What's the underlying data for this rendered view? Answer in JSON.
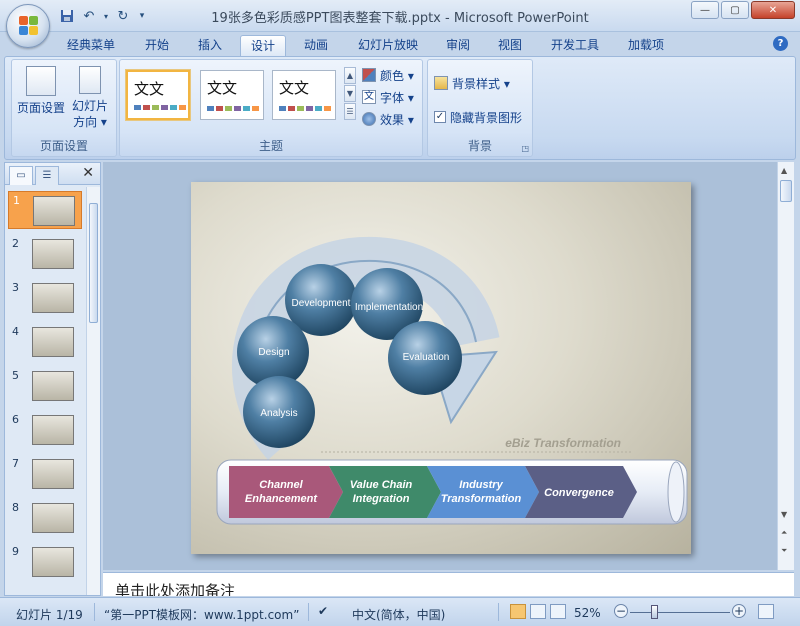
{
  "window": {
    "title": "19张多色彩质感PPT图表整套下载.pptx - Microsoft PowerPoint",
    "minimize": "—",
    "maximize": "▢",
    "close": "✕"
  },
  "quick_access": {
    "save_icon": "save-icon",
    "undo_icon": "undo-icon",
    "redo_icon": "redo-icon"
  },
  "tabs": [
    {
      "label": "经典菜单",
      "active": false
    },
    {
      "label": "开始",
      "active": false
    },
    {
      "label": "插入",
      "active": false
    },
    {
      "label": "设计",
      "active": true
    },
    {
      "label": "动画",
      "active": false
    },
    {
      "label": "幻灯片放映",
      "active": false
    },
    {
      "label": "审阅",
      "active": false
    },
    {
      "label": "视图",
      "active": false
    },
    {
      "label": "开发工具",
      "active": false
    },
    {
      "label": "加载项",
      "active": false
    }
  ],
  "ribbon": {
    "page_setup": {
      "group_label": "页面设置",
      "page_setup_btn": "页面设置",
      "orientation_btn_line1": "幻灯片",
      "orientation_btn_line2": "方向 ▾"
    },
    "themes": {
      "group_label": "主题",
      "items": [
        "文文",
        "文文",
        "文文"
      ],
      "colors": "颜色 ▾",
      "fonts": "字体 ▾",
      "effects": "效果 ▾"
    },
    "background": {
      "group_label": "背景",
      "bg_styles": "背景样式 ▾",
      "hide_bg": "隐藏背景图形",
      "hide_bg_checked": true
    }
  },
  "slides_pane": {
    "numbers": [
      "1",
      "2",
      "3",
      "4",
      "5",
      "6",
      "7",
      "8",
      "9"
    ],
    "active_index": 0
  },
  "slide": {
    "cycle_labels": [
      "Development",
      "Implementation",
      "Design",
      "Evaluation",
      "Analysis"
    ],
    "watermark": "eBiz Transformation",
    "chevrons": [
      {
        "line1": "Channel",
        "line2": "Enhancement",
        "color": "#a9587a"
      },
      {
        "line1": "Value Chain",
        "line2": "Integration",
        "color": "#3f8a6a"
      },
      {
        "line1": "Industry",
        "line2": "Transformation",
        "color": "#5a90d4"
      },
      {
        "line1": "Convergence",
        "line2": "",
        "color": "#5b5f86"
      }
    ]
  },
  "notes": {
    "placeholder": "单击此处添加备注"
  },
  "statusbar": {
    "slide_indicator": "幻灯片 1/19",
    "theme_name": "“第一PPT模板网：www.1ppt.com”",
    "language": "中文(简体，中国)",
    "zoom": "52%"
  }
}
